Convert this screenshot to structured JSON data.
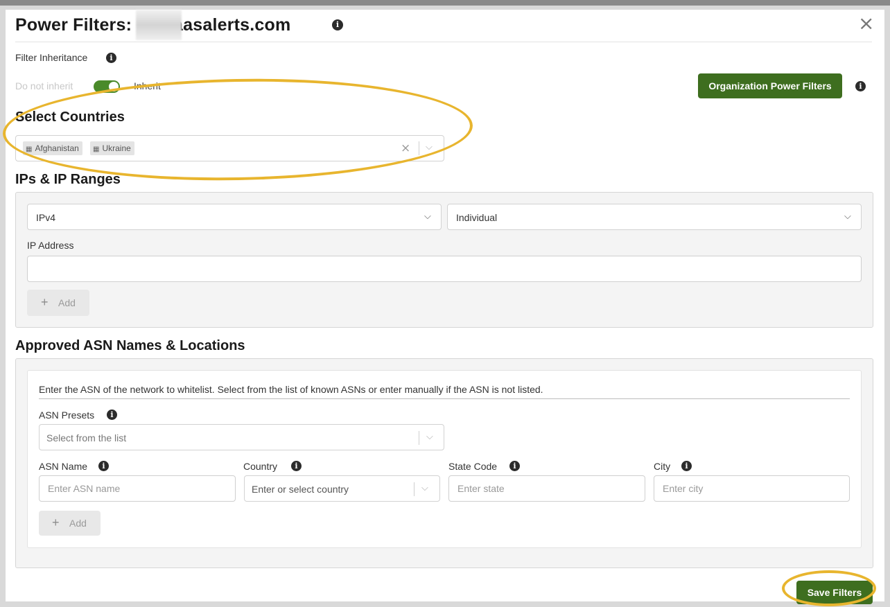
{
  "dialog": {
    "title_prefix": "Power Filters: a",
    "title_suffix": "@saasalerts.com",
    "close_glyph": "×"
  },
  "inheritance": {
    "label": "Filter Inheritance",
    "off_label": "Do not inherit",
    "on_label": "Inherit",
    "toggle_on": true,
    "org_button": "Organization Power Filters"
  },
  "countries": {
    "title": "Select Countries",
    "selected": [
      "Afghanistan",
      "Ukraine"
    ]
  },
  "ip_ranges": {
    "title": "IPs & IP Ranges",
    "version_value": "IPv4",
    "mode_value": "Individual",
    "ip_label": "IP Address",
    "ip_value": "",
    "add_label": "Add"
  },
  "asn": {
    "title": "Approved ASN Names & Locations",
    "description": "Enter the ASN of the network to whitelist. Select from the list of known ASNs or enter manually if the ASN is not listed.",
    "presets_label": "ASN Presets",
    "presets_placeholder": "Select from the list",
    "name_label": "ASN Name",
    "name_placeholder": "Enter ASN name",
    "country_label": "Country",
    "country_placeholder": "Enter or select country",
    "state_label": "State Code",
    "state_placeholder": "Enter state",
    "city_label": "City",
    "city_placeholder": "Enter city",
    "add_label": "Add"
  },
  "footer": {
    "save_label": "Save Filters"
  },
  "colors": {
    "accent_green": "#3e6e1f",
    "highlight": "#e8b52e"
  },
  "icons": {
    "info": "info-icon",
    "close": "close-icon",
    "chevron": "chevron-down-icon",
    "plus": "plus-icon",
    "clear": "clear-icon",
    "chip": "building-icon"
  }
}
